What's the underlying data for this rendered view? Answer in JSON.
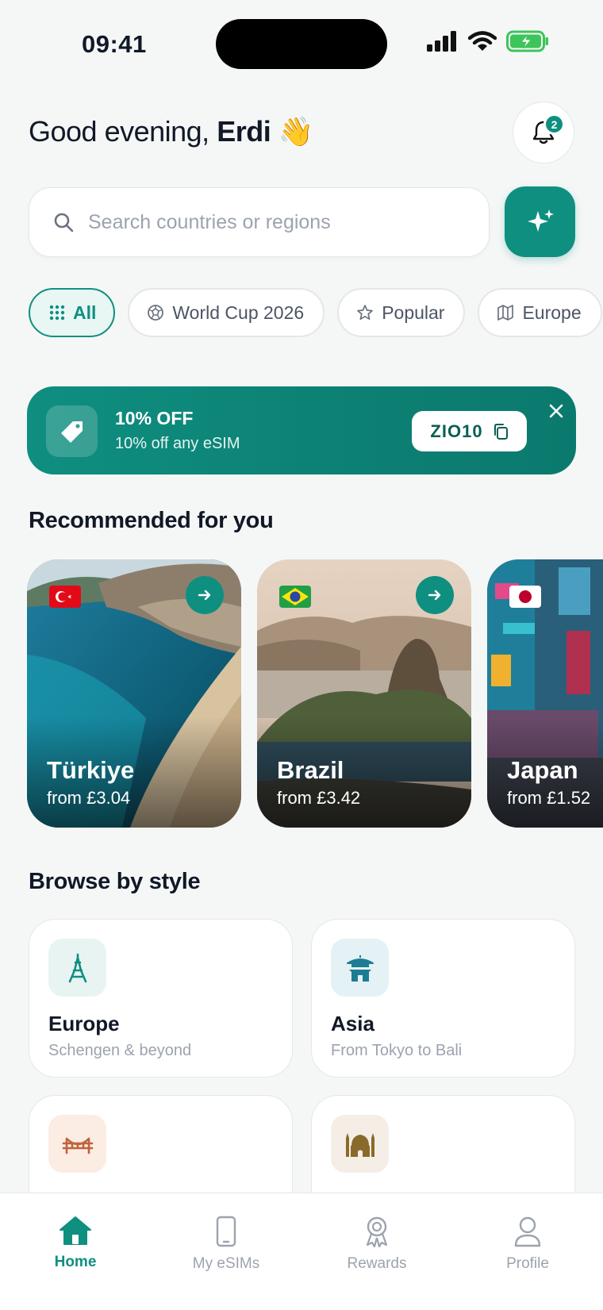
{
  "status_bar": {
    "time": "09:41"
  },
  "header": {
    "greeting": "Good evening,",
    "name": "Erdi",
    "emoji": "👋",
    "notification_count": "2"
  },
  "search": {
    "placeholder": "Search countries or regions"
  },
  "chips": [
    {
      "label": "All",
      "icon": "grid-icon",
      "active": true
    },
    {
      "label": "World Cup 2026",
      "icon": "soccer-ball-icon"
    },
    {
      "label": "Popular",
      "icon": "star-icon"
    },
    {
      "label": "Europe",
      "icon": "map-icon"
    }
  ],
  "promo": {
    "title": "10% OFF",
    "subtitle": "10% off any eSIM",
    "code": "ZIO10"
  },
  "recommended": {
    "title": "Recommended for you",
    "cards": [
      {
        "name": "Türkiye",
        "price": "from £3.04",
        "flag": "turkey-flag"
      },
      {
        "name": "Brazil",
        "price": "from £3.42",
        "flag": "brazil-flag"
      },
      {
        "name": "Japan",
        "price": "from £1.52",
        "flag": "japan-flag"
      }
    ]
  },
  "browse": {
    "title": "Browse by style",
    "items": [
      {
        "name": "Europe",
        "subtitle": "Schengen & beyond",
        "icon": "eiffel-tower-icon"
      },
      {
        "name": "Asia",
        "subtitle": "From Tokyo to Bali",
        "icon": "pagoda-icon"
      },
      {
        "name": "",
        "subtitle": "",
        "icon": "bridge-icon"
      },
      {
        "name": "",
        "subtitle": "",
        "icon": "mosque-icon"
      }
    ]
  },
  "tabbar": [
    {
      "label": "Home",
      "icon": "home-icon",
      "active": true
    },
    {
      "label": "My eSIMs",
      "icon": "phone-icon"
    },
    {
      "label": "Rewards",
      "icon": "award-icon"
    },
    {
      "label": "Profile",
      "icon": "user-icon"
    }
  ],
  "colors": {
    "accent": "#0f8f80",
    "background": "#f5f7f7",
    "text": "#111827",
    "muted": "#9ca3af"
  }
}
